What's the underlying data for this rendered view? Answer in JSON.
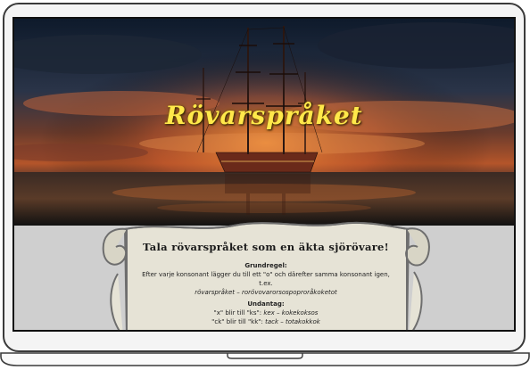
{
  "page": {
    "title": "Rövarspråket",
    "headline": "Tala rövarspråket som en äkta sjörövare!",
    "basic_rule": {
      "heading": "Grundregel:",
      "text": "Efter varje konsonant lägger du till ett \"o\" och därefter samma konsonant igen, t.ex.",
      "example_word": "rövarspråket",
      "example_sep": " – ",
      "example_result": "rorövovarorsospoproråkoketot"
    },
    "exceptions": {
      "heading": "Undantag:",
      "rules": [
        {
          "text": "\"x\" blir till \"ks\": ",
          "word": "kex",
          "sep": " – ",
          "result": "kokekoksos"
        },
        {
          "text": "\"ck\" blir till \"kk\": ",
          "word": "tack",
          "sep": " – ",
          "result": "totakokkok"
        }
      ]
    },
    "colors": {
      "title": "#ffe84a",
      "content_bg": "#cfcfcf",
      "parchment": "#e6e3d6"
    }
  }
}
